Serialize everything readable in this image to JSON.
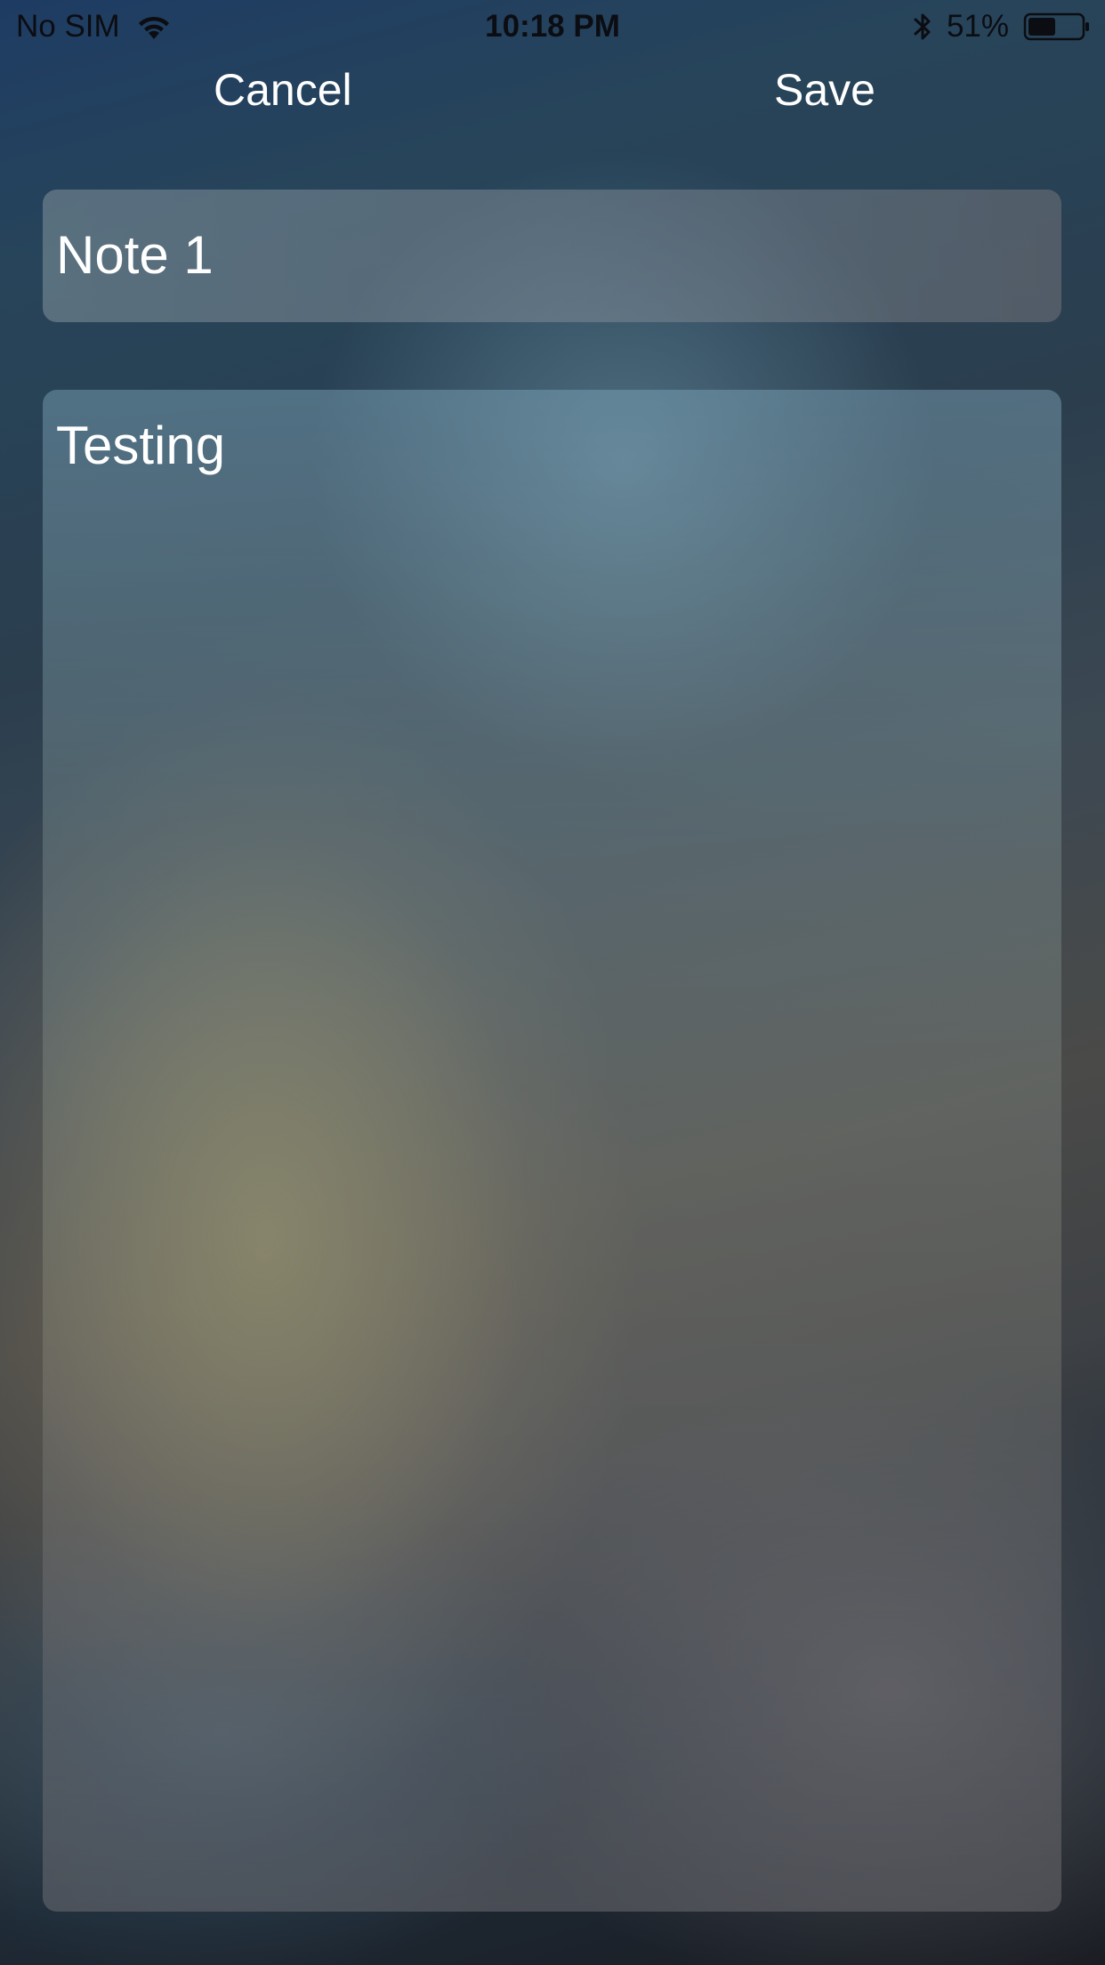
{
  "status_bar": {
    "carrier": "No SIM",
    "time": "10:18 PM",
    "battery": "51%",
    "battery_level": 0.51,
    "icons": [
      "wifi-icon",
      "bluetooth-icon",
      "battery-icon"
    ]
  },
  "nav": {
    "cancel_label": "Cancel",
    "save_label": "Save"
  },
  "note": {
    "title": "Note 1",
    "body": "Testing"
  },
  "colors": {
    "text": "#ffffff",
    "status_text": "#0b0d12"
  }
}
